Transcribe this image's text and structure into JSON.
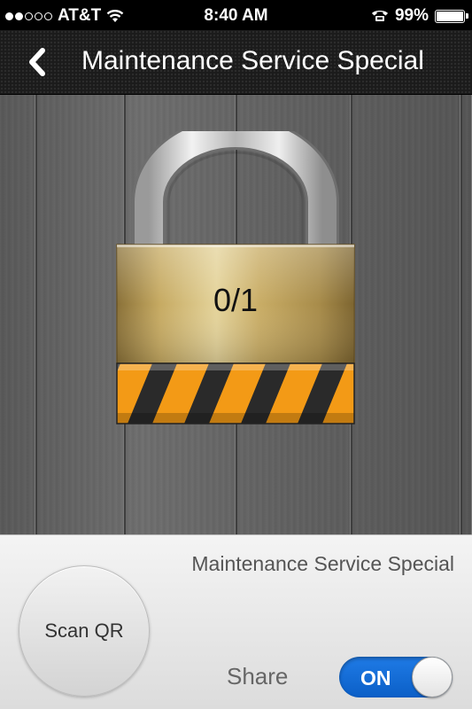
{
  "status_bar": {
    "carrier": "AT&T",
    "time": "8:40 AM",
    "battery": "99%",
    "signal_bars_filled": 2,
    "signal_bars_total": 5
  },
  "nav": {
    "title": "Maintenance Service Special",
    "back_icon": "chevron-left-icon"
  },
  "lock": {
    "counter": "0/1",
    "state": "locked"
  },
  "panel": {
    "title": "Maintenance Service Special",
    "scan_label": "Scan QR",
    "share_label": "Share",
    "share_toggle": "ON"
  },
  "colors": {
    "toggle_on": "#1f7be6",
    "stripe_orange": "#f39a16",
    "lock_gold": "#c9ae6a"
  }
}
